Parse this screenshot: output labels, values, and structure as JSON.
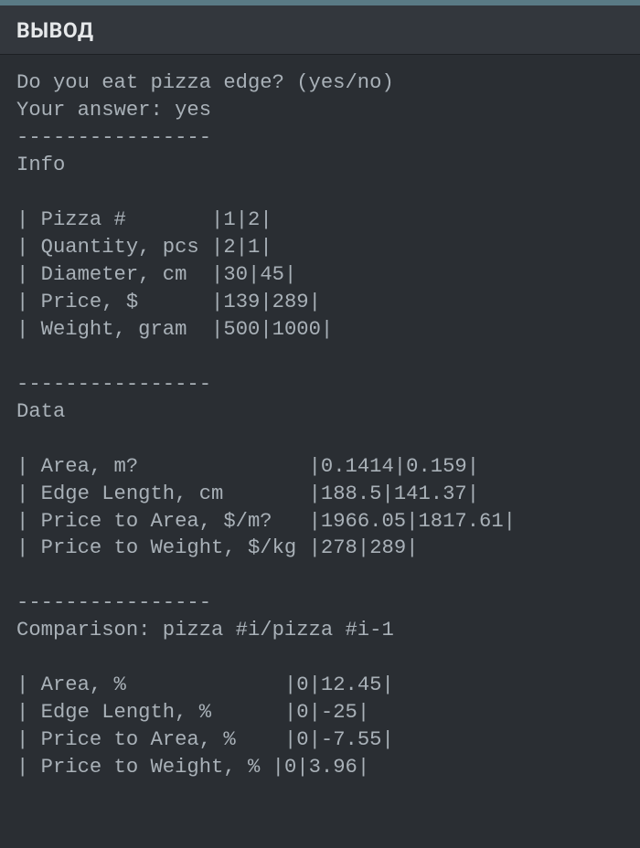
{
  "header": {
    "title": "ВЫВОД"
  },
  "output": {
    "question": "Do you eat pizza edge? (yes/no)",
    "answer_label": "Your answer: ",
    "answer_value": "yes",
    "separator": "----------------",
    "sections": {
      "info": {
        "heading": "Info",
        "rows": [
          {
            "label": "Pizza #       ",
            "v1": "1",
            "v2": "2"
          },
          {
            "label": "Quantity, pcs ",
            "v1": "2",
            "v2": "1"
          },
          {
            "label": "Diameter, cm  ",
            "v1": "30",
            "v2": "45"
          },
          {
            "label": "Price, $      ",
            "v1": "139",
            "v2": "289"
          },
          {
            "label": "Weight, gram  ",
            "v1": "500",
            "v2": "1000"
          }
        ]
      },
      "data": {
        "heading": "Data",
        "rows": [
          {
            "label": "Area, m?              ",
            "v1": "0.1414",
            "v2": "0.159"
          },
          {
            "label": "Edge Length, cm       ",
            "v1": "188.5",
            "v2": "141.37"
          },
          {
            "label": "Price to Area, $/m?   ",
            "v1": "1966.05",
            "v2": "1817.61"
          },
          {
            "label": "Price to Weight, $/kg ",
            "v1": "278",
            "v2": "289"
          }
        ]
      },
      "comparison": {
        "heading": "Comparison: pizza #i/pizza #i-1",
        "rows": [
          {
            "label": "Area, %             ",
            "v1": "0",
            "v2": "12.45"
          },
          {
            "label": "Edge Length, %      ",
            "v1": "0",
            "v2": "-25"
          },
          {
            "label": "Price to Area, %    ",
            "v1": "0",
            "v2": "-7.55"
          },
          {
            "label": "Price to Weight, % ",
            "v1": "0",
            "v2": "3.96"
          }
        ]
      }
    }
  }
}
